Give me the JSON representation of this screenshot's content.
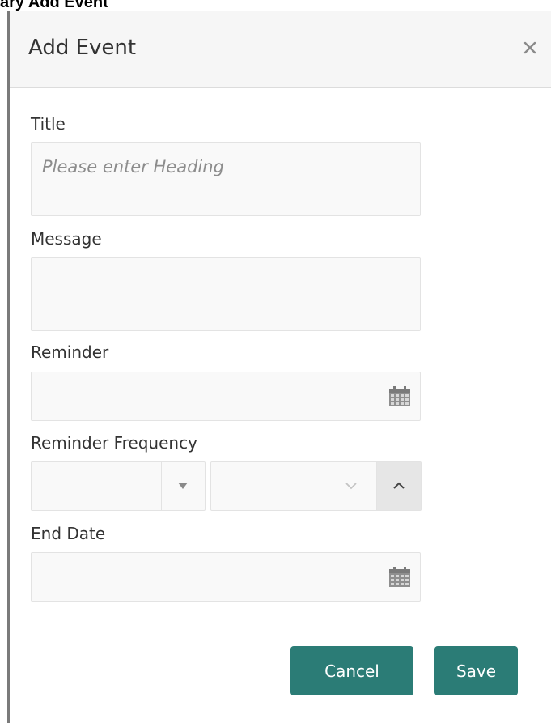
{
  "page": {
    "heading": "ary Add Event"
  },
  "dialog": {
    "title": "Add Event",
    "close_icon": "close-icon"
  },
  "form": {
    "title": {
      "label": "Title",
      "value": "",
      "placeholder": "Please enter Heading"
    },
    "message": {
      "label": "Message",
      "value": ""
    },
    "reminder": {
      "label": "Reminder",
      "value": "",
      "icon": "calendar-icon"
    },
    "reminder_frequency": {
      "label": "Reminder Frequency",
      "interval_value": "",
      "unit_value": "",
      "icons": [
        "chevron-down-icon",
        "chevron-up-icon"
      ]
    },
    "end_date": {
      "label": "End Date",
      "value": "",
      "icon": "calendar-icon"
    }
  },
  "actions": {
    "cancel_label": "Cancel",
    "save_label": "Save"
  },
  "colors": {
    "primary_button": "#2b7c76",
    "header_bg": "#f6f6f6",
    "field_bg": "#f9f9f9"
  }
}
